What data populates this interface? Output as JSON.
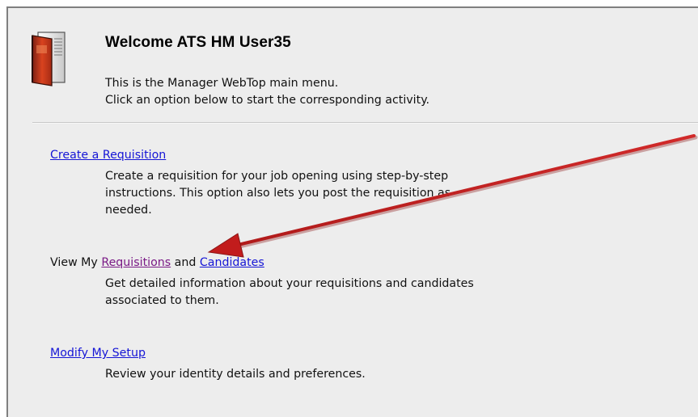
{
  "header": {
    "title": "Welcome ATS HM User35",
    "line1": "This is the Manager WebTop main menu.",
    "line2": "Click an option below to start the corresponding activity."
  },
  "options": {
    "create": {
      "link": "Create a Requisition",
      "desc1": "Create a requisition for your job opening using step-by-step",
      "desc2": "instructions. This option also lets you post the requisition as",
      "desc3": "needed."
    },
    "view": {
      "prefix": "View My",
      "link1": "Requisitions",
      "middle": "and",
      "link2": "Candidates",
      "desc1": "Get detailed information about your requisitions and candidates",
      "desc2": "associated to them."
    },
    "setup": {
      "link": "Modify My Setup",
      "desc1": "Review your identity details and preferences."
    }
  },
  "icons": {
    "book": "book-icon",
    "arrow": "red-arrow"
  },
  "colors": {
    "link": "#1515d6",
    "visited_link": "#7a1a86",
    "arrow": "#c21c1c",
    "panel_bg": "#ededed"
  }
}
